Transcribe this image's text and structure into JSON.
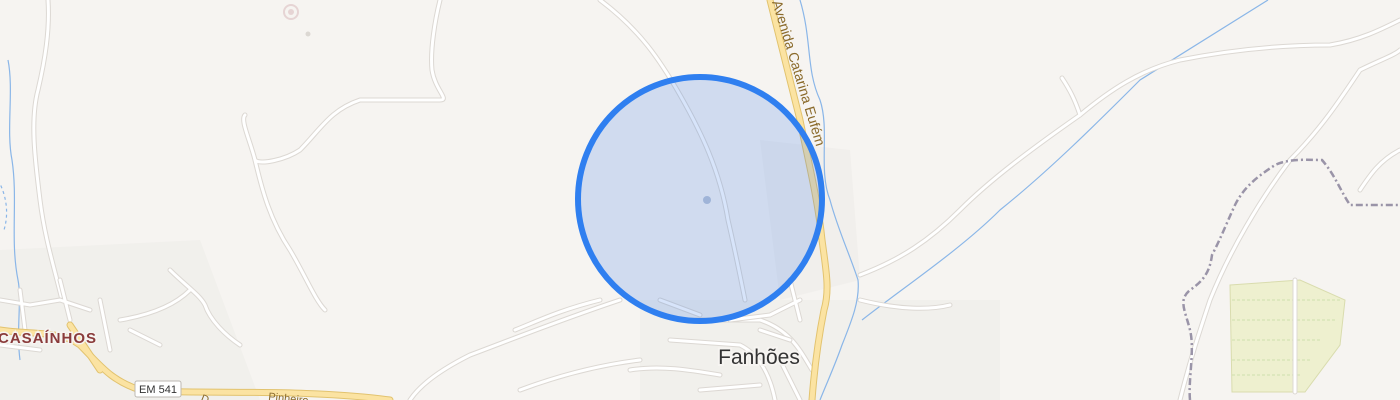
{
  "map": {
    "places": {
      "town": "Fanhões",
      "locality": "CASAÍNHOS"
    },
    "roads": {
      "avenue": "Avenida Catarina Eufém",
      "route_shield": "EM 541",
      "lower_street": "Pinheiro"
    },
    "colors": {
      "background": "#f6f4f1",
      "road_minor": "#ffffff",
      "road_minor_casing": "#dcd8d3",
      "road_major": "#fbe3a2",
      "road_major_casing": "#e2c36f",
      "water": "#8ab6e8",
      "boundary": "#9a94a8",
      "locator_fill": "#4a86e8",
      "locator_stroke": "#2f7ff0",
      "field": "#eef0cf"
    },
    "locator": {
      "style": "accuracy-circle"
    }
  }
}
